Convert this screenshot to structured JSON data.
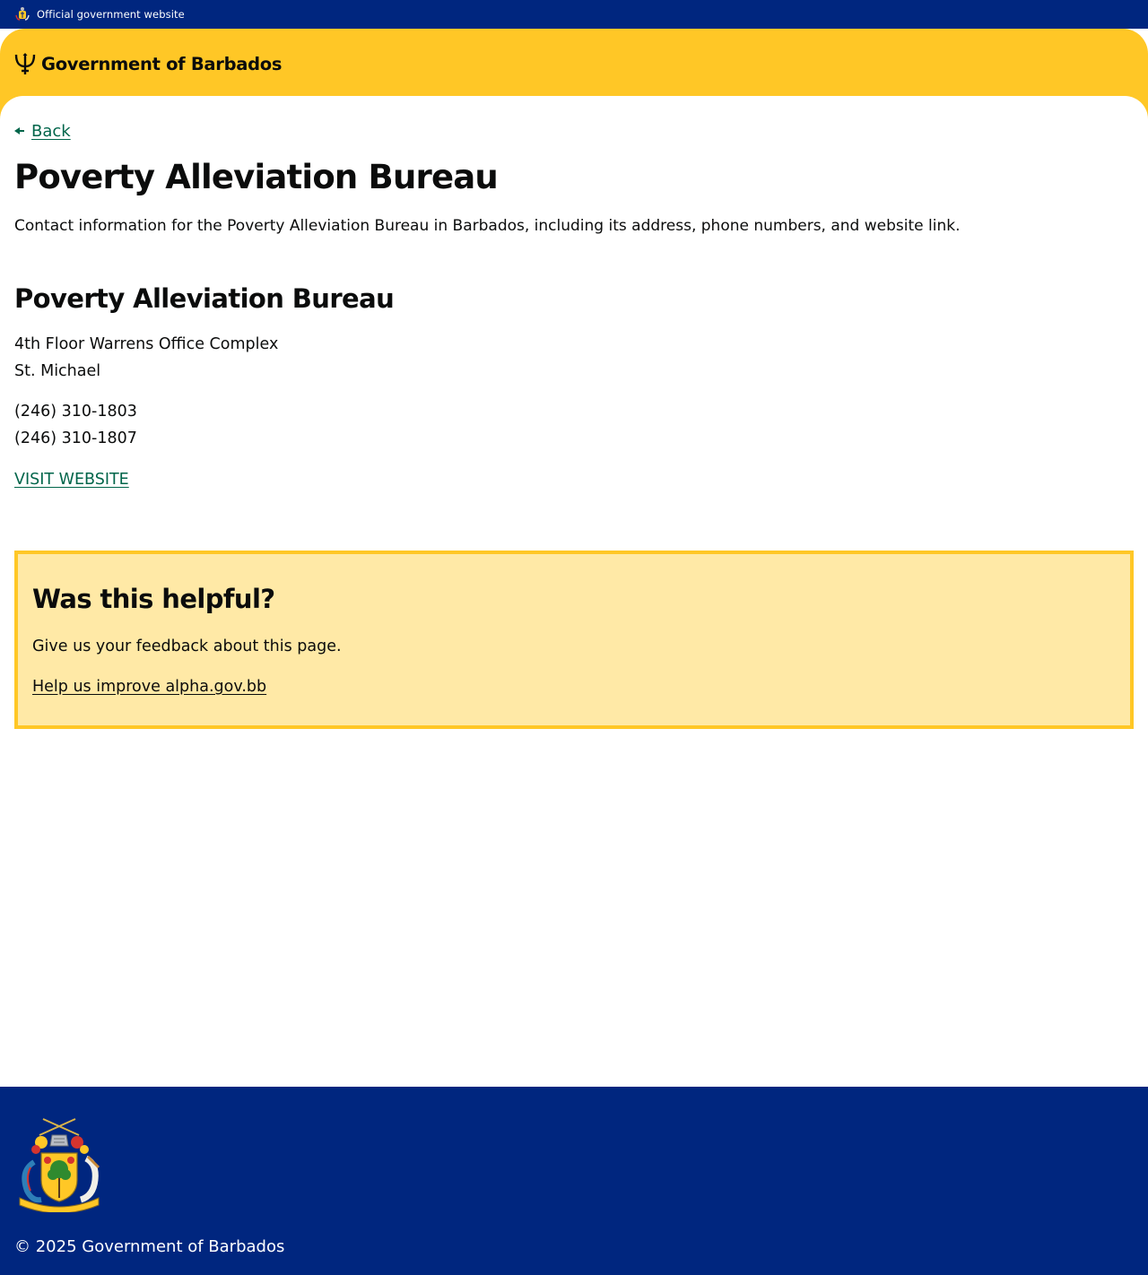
{
  "official_banner": {
    "text": "Official government website"
  },
  "header": {
    "brand": "Government of Barbados"
  },
  "navigation": {
    "back_label": "Back"
  },
  "page": {
    "title": "Poverty Alleviation Bureau",
    "description": "Contact information for the Poverty Alleviation Bureau in Barbados, including its address, phone numbers, and website link."
  },
  "contact": {
    "name": "Poverty Alleviation Bureau",
    "address_lines": [
      "4th Floor Warrens Office Complex",
      "St. Michael"
    ],
    "phones": [
      "(246) 310-1803",
      "(246) 310-1807"
    ],
    "website_label": "VISIT WEBSITE"
  },
  "feedback": {
    "title": "Was this helpful?",
    "text": "Give us your feedback about this page.",
    "link_label": "Help us improve alpha.gov.bb"
  },
  "footer": {
    "copyright": "© 2025 Government of Barbados"
  },
  "colors": {
    "navy": "#00267f",
    "gold": "#ffc726",
    "feedback_bg": "#ffe9a6",
    "link_green": "#00654a"
  },
  "icons": {
    "official_crest": "crest-icon",
    "brand_mark": "trident-icon",
    "back": "arrow-left-icon",
    "footer_arms": "coat-of-arms-icon"
  }
}
